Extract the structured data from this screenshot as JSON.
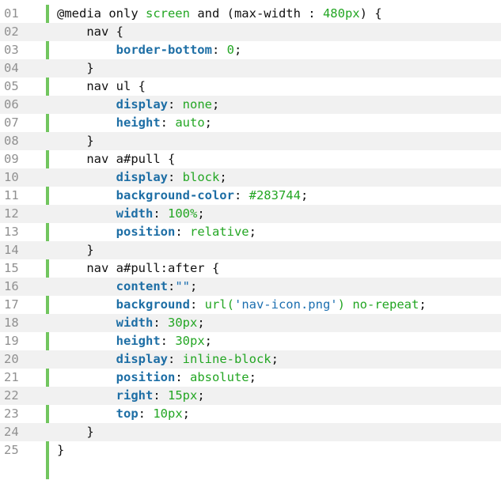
{
  "code": {
    "lines": [
      {
        "number": "01",
        "tokens": [
          [
            "plain",
            "@media only "
          ],
          [
            "value",
            "screen"
          ],
          [
            "plain",
            " and (max-width : "
          ],
          [
            "value",
            "480px"
          ],
          [
            "plain",
            ") {"
          ]
        ]
      },
      {
        "number": "02",
        "tokens": [
          [
            "plain",
            "    nav {"
          ]
        ]
      },
      {
        "number": "03",
        "tokens": [
          [
            "plain",
            "        "
          ],
          [
            "prop",
            "border-bottom"
          ],
          [
            "plain",
            ": "
          ],
          [
            "value",
            "0"
          ],
          [
            "plain",
            ";"
          ]
        ]
      },
      {
        "number": "04",
        "tokens": [
          [
            "plain",
            "    }"
          ]
        ]
      },
      {
        "number": "05",
        "tokens": [
          [
            "plain",
            "    nav ul {"
          ]
        ]
      },
      {
        "number": "06",
        "tokens": [
          [
            "plain",
            "        "
          ],
          [
            "prop",
            "display"
          ],
          [
            "plain",
            ": "
          ],
          [
            "value",
            "none"
          ],
          [
            "plain",
            ";"
          ]
        ]
      },
      {
        "number": "07",
        "tokens": [
          [
            "plain",
            "        "
          ],
          [
            "prop",
            "height"
          ],
          [
            "plain",
            ": "
          ],
          [
            "value",
            "auto"
          ],
          [
            "plain",
            ";"
          ]
        ]
      },
      {
        "number": "08",
        "tokens": [
          [
            "plain",
            "    }"
          ]
        ]
      },
      {
        "number": "09",
        "tokens": [
          [
            "plain",
            "    nav a#pull {"
          ]
        ]
      },
      {
        "number": "10",
        "tokens": [
          [
            "plain",
            "        "
          ],
          [
            "prop",
            "display"
          ],
          [
            "plain",
            ": "
          ],
          [
            "value",
            "block"
          ],
          [
            "plain",
            ";"
          ]
        ]
      },
      {
        "number": "11",
        "tokens": [
          [
            "plain",
            "        "
          ],
          [
            "prop",
            "background-color"
          ],
          [
            "plain",
            ": "
          ],
          [
            "value",
            "#283744"
          ],
          [
            "plain",
            ";"
          ]
        ]
      },
      {
        "number": "12",
        "tokens": [
          [
            "plain",
            "        "
          ],
          [
            "prop",
            "width"
          ],
          [
            "plain",
            ": "
          ],
          [
            "value",
            "100%"
          ],
          [
            "plain",
            ";"
          ]
        ]
      },
      {
        "number": "13",
        "tokens": [
          [
            "plain",
            "        "
          ],
          [
            "prop",
            "position"
          ],
          [
            "plain",
            ": "
          ],
          [
            "value",
            "relative"
          ],
          [
            "plain",
            ";"
          ]
        ]
      },
      {
        "number": "14",
        "tokens": [
          [
            "plain",
            "    }"
          ]
        ]
      },
      {
        "number": "15",
        "tokens": [
          [
            "plain",
            "    nav a#pull:after {"
          ]
        ]
      },
      {
        "number": "16",
        "tokens": [
          [
            "plain",
            "        "
          ],
          [
            "prop",
            "content"
          ],
          [
            "plain",
            ":"
          ],
          [
            "string",
            "\"\""
          ],
          [
            "plain",
            ";"
          ]
        ]
      },
      {
        "number": "17",
        "wrapped": true,
        "tokens": [
          [
            "plain",
            "        "
          ],
          [
            "prop",
            "background"
          ],
          [
            "plain",
            ": "
          ],
          [
            "value",
            "url("
          ],
          [
            "string",
            "'nav-icon.png'"
          ],
          [
            "value",
            ")"
          ],
          [
            "plain",
            " "
          ],
          [
            "value",
            "no-repeat"
          ],
          [
            "plain",
            ";"
          ]
        ]
      },
      {
        "number": "18",
        "tokens": [
          [
            "plain",
            "        "
          ],
          [
            "prop",
            "width"
          ],
          [
            "plain",
            ": "
          ],
          [
            "value",
            "30px"
          ],
          [
            "plain",
            ";"
          ]
        ]
      },
      {
        "number": "19",
        "tokens": [
          [
            "plain",
            "        "
          ],
          [
            "prop",
            "height"
          ],
          [
            "plain",
            ": "
          ],
          [
            "value",
            "30px"
          ],
          [
            "plain",
            ";"
          ]
        ]
      },
      {
        "number": "20",
        "tokens": [
          [
            "plain",
            "        "
          ],
          [
            "prop",
            "display"
          ],
          [
            "plain",
            ": "
          ],
          [
            "value",
            "inline-block"
          ],
          [
            "plain",
            ";"
          ]
        ]
      },
      {
        "number": "21",
        "tokens": [
          [
            "plain",
            "        "
          ],
          [
            "prop",
            "position"
          ],
          [
            "plain",
            ": "
          ],
          [
            "value",
            "absolute"
          ],
          [
            "plain",
            ";"
          ]
        ]
      },
      {
        "number": "22",
        "tokens": [
          [
            "plain",
            "        "
          ],
          [
            "prop",
            "right"
          ],
          [
            "plain",
            ": "
          ],
          [
            "value",
            "15px"
          ],
          [
            "plain",
            ";"
          ]
        ]
      },
      {
        "number": "23",
        "tokens": [
          [
            "plain",
            "        "
          ],
          [
            "prop",
            "top"
          ],
          [
            "plain",
            ": "
          ],
          [
            "value",
            "10px"
          ],
          [
            "plain",
            ";"
          ]
        ]
      },
      {
        "number": "24",
        "tokens": [
          [
            "plain",
            "    }"
          ]
        ]
      },
      {
        "number": "25",
        "tokens": [
          [
            "plain",
            "}"
          ]
        ]
      }
    ]
  },
  "colors": {
    "gutter_rule": "#72c65f",
    "alt_row": "#f1f1f1",
    "line_number": "#909090",
    "property": "#1d6ea5",
    "value": "#23a623",
    "string": "#1c6fb0"
  }
}
